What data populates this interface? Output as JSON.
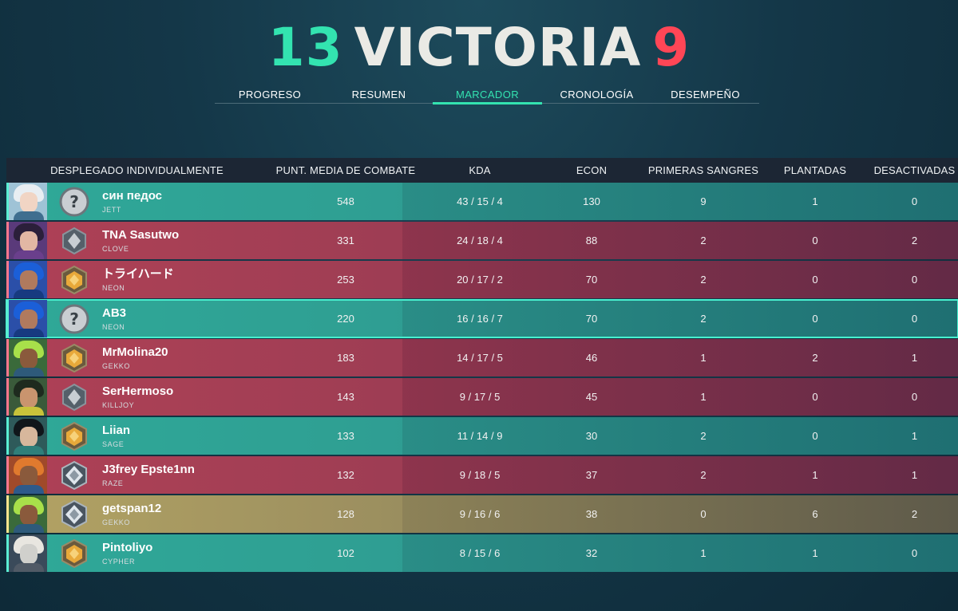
{
  "header": {
    "score_left": "13",
    "result": "VICTORIA",
    "score_right": "9"
  },
  "tabs": [
    {
      "label": "PROGRESO"
    },
    {
      "label": "RESUMEN"
    },
    {
      "label": "MARCADOR"
    },
    {
      "label": "CRONOLOGÍA"
    },
    {
      "label": "DESEMPEÑO"
    }
  ],
  "active_tab": "MARCADOR",
  "table": {
    "columns": [
      "DESPLEGADO INDIVIDUALMENTE",
      "PUNT. MEDIA DE COMBATE",
      "KDA",
      "ECON",
      "PRIMERAS SANGRES",
      "PLANTADAS",
      "DESACTIVADAS"
    ],
    "rows": [
      {
        "name": "син педос",
        "agent": "JETT",
        "acs": "548",
        "kda": "43 / 15 / 4",
        "econ": "130",
        "first_bloods": "9",
        "plants": "1",
        "defuses": "0",
        "team": "green",
        "rank": "unranked",
        "self": false
      },
      {
        "name": "TNA Sasutwo",
        "agent": "CLOVE",
        "acs": "331",
        "kda": "24 / 18 / 4",
        "econ": "88",
        "first_bloods": "2",
        "plants": "0",
        "defuses": "2",
        "team": "red",
        "rank": "silver",
        "self": false
      },
      {
        "name": "トライハード",
        "agent": "NEON",
        "acs": "253",
        "kda": "20 / 17 / 2",
        "econ": "70",
        "first_bloods": "2",
        "plants": "0",
        "defuses": "0",
        "team": "red",
        "rank": "gold",
        "self": false
      },
      {
        "name": "AB3",
        "agent": "NEON",
        "acs": "220",
        "kda": "16 / 16 / 7",
        "econ": "70",
        "first_bloods": "2",
        "plants": "0",
        "defuses": "0",
        "team": "green",
        "rank": "unranked",
        "self": true
      },
      {
        "name": "MrMolina20",
        "agent": "GEKKO",
        "acs": "183",
        "kda": "14 / 17 / 5",
        "econ": "46",
        "first_bloods": "1",
        "plants": "2",
        "defuses": "1",
        "team": "red",
        "rank": "gold",
        "self": false
      },
      {
        "name": "SerHermoso",
        "agent": "KILLJOY",
        "acs": "143",
        "kda": "9 / 17 / 5",
        "econ": "45",
        "first_bloods": "1",
        "plants": "0",
        "defuses": "0",
        "team": "red",
        "rank": "silver",
        "self": false
      },
      {
        "name": "Liian",
        "agent": "SAGE",
        "acs": "133",
        "kda": "11 / 14 / 9",
        "econ": "30",
        "first_bloods": "2",
        "plants": "0",
        "defuses": "1",
        "team": "green",
        "rank": "gold",
        "self": false
      },
      {
        "name": "J3frey Epste1nn",
        "agent": "RAZE",
        "acs": "132",
        "kda": "9 / 18 / 5",
        "econ": "37",
        "first_bloods": "2",
        "plants": "1",
        "defuses": "1",
        "team": "red",
        "rank": "platinum",
        "self": false
      },
      {
        "name": "getspan12",
        "agent": "GEKKO",
        "acs": "128",
        "kda": "9 / 16 / 6",
        "econ": "38",
        "first_bloods": "0",
        "plants": "6",
        "defuses": "2",
        "team": "gold",
        "rank": "platinum",
        "self": false
      },
      {
        "name": "Pintoliyo",
        "agent": "CYPHER",
        "acs": "102",
        "kda": "8 / 15 / 6",
        "econ": "32",
        "first_bloods": "1",
        "plants": "1",
        "defuses": "0",
        "team": "green",
        "rank": "gold",
        "self": false
      }
    ]
  },
  "colors": {
    "win_accent": "#33e3b0",
    "loss_accent": "#ff4656",
    "team_green": "#2a9b8e",
    "team_red": "#a23a50",
    "team_gold": "#a89a5e"
  },
  "agent_palettes": {
    "JETT": [
      "#9fc3d6",
      "#e8eef2",
      "#f1d5c4",
      "#3f6e8f"
    ],
    "CLOVE": [
      "#5a3a7a",
      "#2b1f3a",
      "#e2b7a4",
      "#6a3f8c"
    ],
    "NEON": [
      "#2b4fa8",
      "#1b5fd8",
      "#b07a5e",
      "#173a80"
    ],
    "GEKKO": [
      "#3a6a3a",
      "#a8e04a",
      "#8a5a3c",
      "#2e5a7a"
    ],
    "KILLJOY": [
      "#3a5a3a",
      "#1e2a1e",
      "#c9946e",
      "#c8c33a"
    ],
    "SAGE": [
      "#2e5a5a",
      "#10161a",
      "#d7b79c",
      "#2f7f7a"
    ],
    "RAZE": [
      "#a04a2a",
      "#e07a2e",
      "#8a5a3c",
      "#2e5a8a"
    ],
    "CYPHER": [
      "#3a4a5a",
      "#e8e6e0",
      "#d0d0cc",
      "#505a66"
    ]
  }
}
